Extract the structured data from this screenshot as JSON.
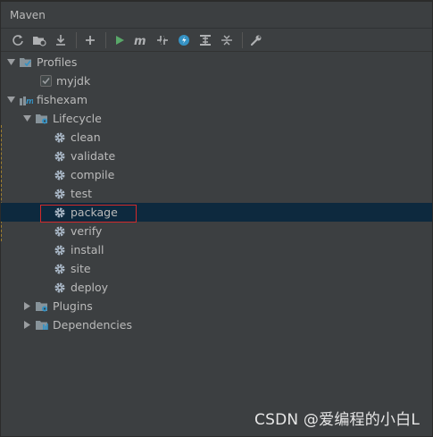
{
  "window": {
    "title": "Maven"
  },
  "toolbar": {
    "buttons": [
      {
        "name": "reload-icon"
      },
      {
        "name": "generate-sources-icon"
      },
      {
        "name": "download-icon"
      },
      {
        "name": "add-icon"
      },
      {
        "name": "run-icon"
      },
      {
        "name": "maven-goal-icon"
      },
      {
        "name": "toggle-offline-icon"
      },
      {
        "name": "skip-tests-icon"
      },
      {
        "name": "show-dependencies-icon"
      },
      {
        "name": "collapse-all-icon"
      },
      {
        "name": "settings-wrench-icon"
      }
    ]
  },
  "tree": {
    "profiles": {
      "label": "Profiles",
      "items": [
        {
          "label": "myjdk",
          "checked": true
        }
      ]
    },
    "project": {
      "label": "fishexam",
      "lifecycle": {
        "label": "Lifecycle",
        "goals": [
          {
            "label": "clean"
          },
          {
            "label": "validate"
          },
          {
            "label": "compile"
          },
          {
            "label": "test"
          },
          {
            "label": "package",
            "selected": true
          },
          {
            "label": "verify"
          },
          {
            "label": "install"
          },
          {
            "label": "site"
          },
          {
            "label": "deploy"
          }
        ]
      },
      "plugins": {
        "label": "Plugins"
      },
      "dependencies": {
        "label": "Dependencies"
      }
    }
  },
  "watermark": "CSDN @爱编程的小白L",
  "colors": {
    "background": "#3c3f41",
    "selected_row": "#0d293e",
    "highlight_border": "#d32a2a",
    "run_green": "#59a869",
    "accent_blue": "#3592c4"
  }
}
